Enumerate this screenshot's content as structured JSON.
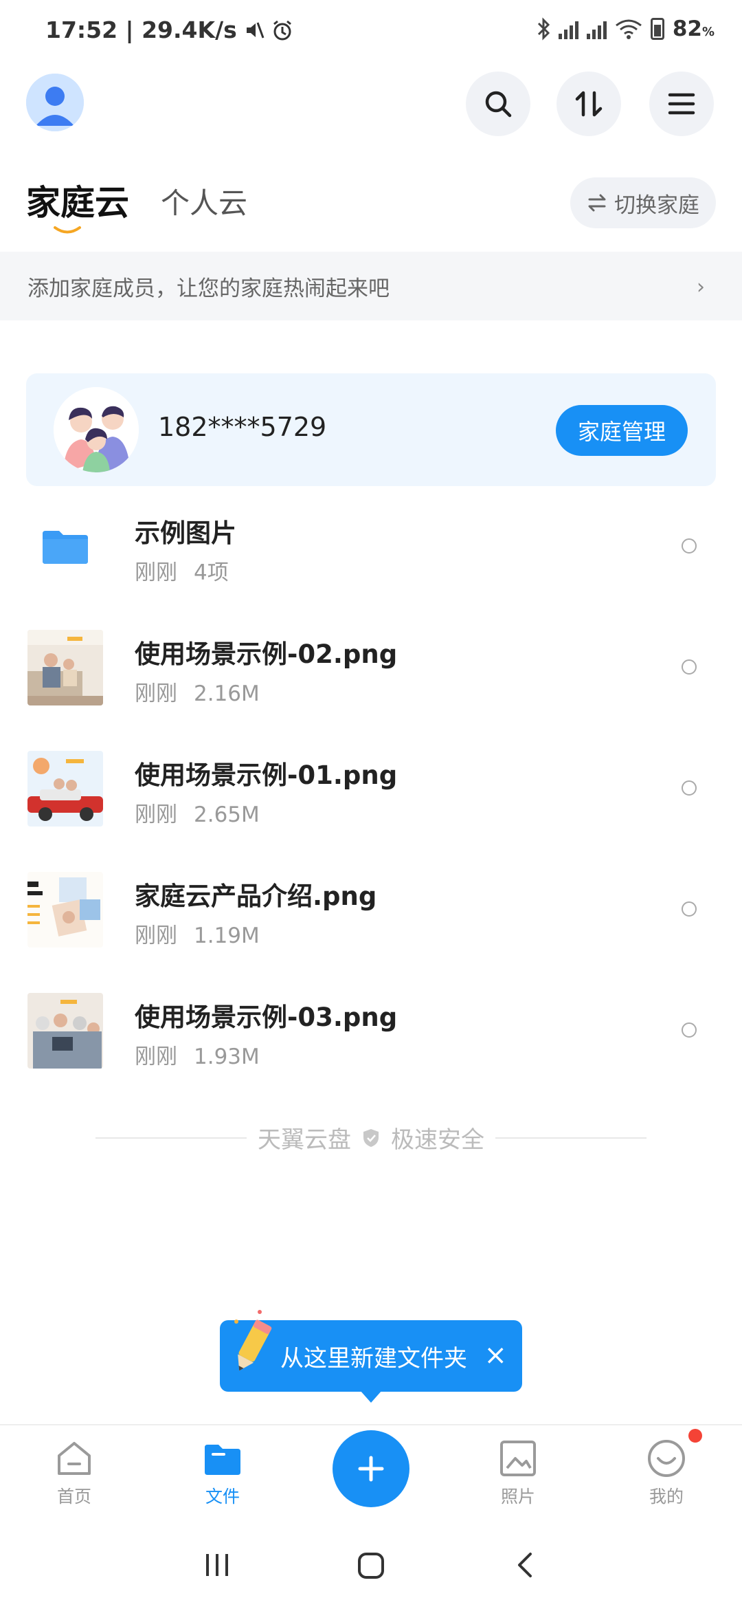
{
  "status_bar": {
    "time": "17:52 | 29.4K/s",
    "battery": "82",
    "battery_unit": "%"
  },
  "header": {
    "icons": [
      "avatar-icon",
      "search-icon",
      "transfer-icon",
      "menu-icon"
    ]
  },
  "tabs": {
    "active": "家庭云",
    "inactive": "个人云",
    "switch_label": "切换家庭"
  },
  "invite_banner": {
    "text": "添加家庭成员，让您的家庭热闹起来吧",
    "arrow": "›"
  },
  "family_card": {
    "phone": "182****5729",
    "manage_button": "家庭管理"
  },
  "files": [
    {
      "name": "示例图片",
      "time": "刚刚",
      "size": "4项",
      "type": "folder"
    },
    {
      "name": "使用场景示例-02.png",
      "time": "刚刚",
      "size": "2.16M",
      "type": "image"
    },
    {
      "name": "使用场景示例-01.png",
      "time": "刚刚",
      "size": "2.65M",
      "type": "image"
    },
    {
      "name": "家庭云产品介绍.png",
      "time": "刚刚",
      "size": "1.19M",
      "type": "image"
    },
    {
      "name": "使用场景示例-03.png",
      "time": "刚刚",
      "size": "1.93M",
      "type": "image"
    }
  ],
  "footer_slogan": {
    "left": "天翼云盘",
    "right": "极速安全"
  },
  "tooltip": {
    "text": "从这里新建文件夹",
    "close": "×"
  },
  "bottom_nav": {
    "items": [
      {
        "label": "首页",
        "icon": "home-icon"
      },
      {
        "label": "文件",
        "icon": "folder-icon"
      },
      {
        "label": "照片",
        "icon": "photo-icon"
      },
      {
        "label": "我的",
        "icon": "smile-icon"
      }
    ],
    "active_index": 1
  },
  "colors": {
    "accent": "#1890f5",
    "tab_underline": "#f5a623",
    "badge": "#f44336"
  }
}
